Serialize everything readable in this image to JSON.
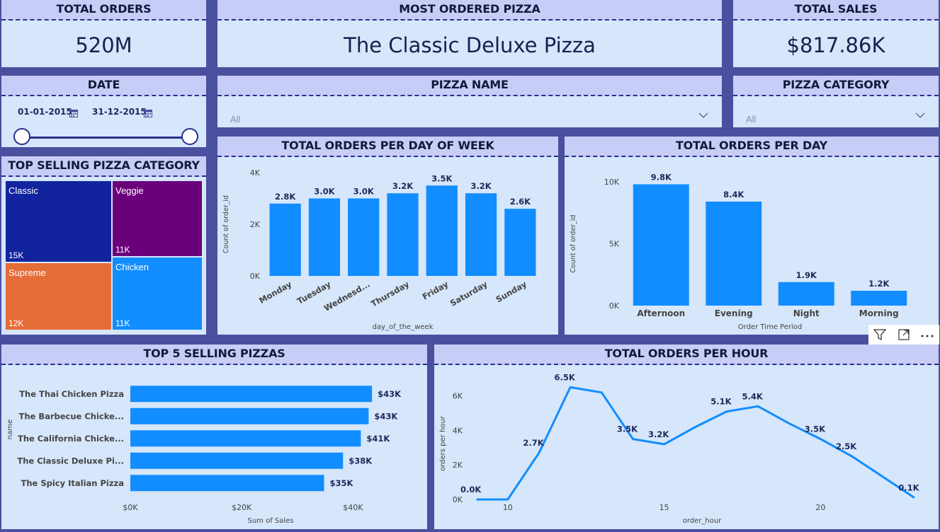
{
  "cards": {
    "total_orders": {
      "title": "TOTAL ORDERS",
      "value": "520M"
    },
    "most_ordered": {
      "title": "MOST ORDERED PIZZA",
      "value": "The Classic Deluxe Pizza"
    },
    "total_sales": {
      "title": "TOTAL SALES",
      "value": "$817.86K"
    }
  },
  "slicers": {
    "date": {
      "title": "DATE",
      "start": "01-01-2015",
      "end": "31-12-2015"
    },
    "pizza_name": {
      "title": "PIZZA NAME",
      "value": "All"
    },
    "pizza_category": {
      "title": "PIZZA CATEGORY",
      "value": "All"
    }
  },
  "treemap": {
    "title": "TOP SELLING PIZZA CATEGORY",
    "items": [
      {
        "label": "Classic",
        "value": "15K",
        "color": "#12239e"
      },
      {
        "label": "Veggie",
        "value": "11K",
        "color": "#6b007b"
      },
      {
        "label": "Supreme",
        "value": "12K",
        "color": "#e66c37"
      },
      {
        "label": "Chicken",
        "value": "11K",
        "color": "#118dff"
      }
    ]
  },
  "visual_headers": {
    "filter_icon": "filter-icon",
    "focus_icon": "focus-mode-icon",
    "more_icon": "more-options-icon"
  },
  "chart_data": [
    {
      "id": "dow",
      "type": "bar",
      "title": "TOTAL ORDERS PER DAY OF WEEK",
      "xlabel": "day_of_the_week",
      "ylabel": "Count of order_id",
      "categories": [
        "Monday",
        "Tuesday",
        "Wednesd...",
        "Thursday",
        "Friday",
        "Saturday",
        "Sunday"
      ],
      "values": [
        2800,
        3000,
        3000,
        3200,
        3500,
        3200,
        2600
      ],
      "data_labels": [
        "2.8K",
        "3.0K",
        "3.0K",
        "3.2K",
        "3.5K",
        "3.2K",
        "2.6K"
      ],
      "yticks": [
        0,
        2000,
        4000
      ],
      "ytick_labels": [
        "0K",
        "2K",
        "4K"
      ],
      "ylim": [
        0,
        4000
      ],
      "color": "#118dff"
    },
    {
      "id": "period",
      "type": "bar",
      "title": "TOTAL ORDERS PER DAY",
      "xlabel": "Order Time Period",
      "ylabel": "Count of order_id",
      "categories": [
        "Afternoon",
        "Evening",
        "Night",
        "Morning"
      ],
      "values": [
        9800,
        8400,
        1900,
        1200
      ],
      "data_labels": [
        "9.8K",
        "8.4K",
        "1.9K",
        "1.2K"
      ],
      "yticks": [
        0,
        5000,
        10000
      ],
      "ytick_labels": [
        "0K",
        "5K",
        "10K"
      ],
      "ylim": [
        0,
        10000
      ],
      "color": "#118dff"
    },
    {
      "id": "top5",
      "type": "bar",
      "orientation": "horizontal",
      "title": "TOP 5 SELLING PIZZAS",
      "xlabel": "Sum of Sales",
      "ylabel": "name",
      "categories": [
        "The Thai Chicken Pizza",
        "The Barbecue Chicke...",
        "The California Chicke...",
        "The Classic Deluxe Pi...",
        "The Spicy Italian Pizza"
      ],
      "values": [
        43400,
        42800,
        41400,
        38200,
        34800
      ],
      "data_labels": [
        "$43K",
        "$43K",
        "$41K",
        "$38K",
        "$35K"
      ],
      "xticks": [
        0,
        20000,
        40000
      ],
      "xtick_labels": [
        "$0K",
        "$20K",
        "$40K"
      ],
      "xlim": [
        0,
        50000
      ],
      "color": "#118dff"
    },
    {
      "id": "hour",
      "type": "line",
      "title": "TOTAL ORDERS PER HOUR",
      "xlabel": "order_hour",
      "ylabel": "orders per hour",
      "x": [
        9,
        10,
        11,
        12,
        13,
        14,
        15,
        16,
        17,
        18,
        19,
        20,
        21,
        22,
        23
      ],
      "values": [
        0,
        0,
        2700,
        6500,
        6200,
        3500,
        3200,
        4200,
        5100,
        5400,
        4400,
        3500,
        2500,
        1300,
        100
      ],
      "labels": [
        {
          "i": 0,
          "text": "0.0K"
        },
        {
          "i": 2,
          "text": "2.7K"
        },
        {
          "i": 3,
          "text": "6.5K"
        },
        {
          "i": 5,
          "text": "3.5K"
        },
        {
          "i": 6,
          "text": "3.2K"
        },
        {
          "i": 8,
          "text": "5.1K"
        },
        {
          "i": 9,
          "text": "5.4K"
        },
        {
          "i": 11,
          "text": "3.5K"
        },
        {
          "i": 12,
          "text": "2.5K"
        },
        {
          "i": 14,
          "text": "0.1K"
        }
      ],
      "xticks": [
        10,
        15,
        20
      ],
      "xtick_labels": [
        "10",
        "15",
        "20"
      ],
      "yticks": [
        0,
        2000,
        4000,
        6000
      ],
      "ytick_labels": [
        "0K",
        "2K",
        "4K",
        "6K"
      ],
      "xlim": [
        8.6,
        23.5
      ],
      "ylim": [
        0,
        6600
      ],
      "color": "#118dff"
    }
  ]
}
